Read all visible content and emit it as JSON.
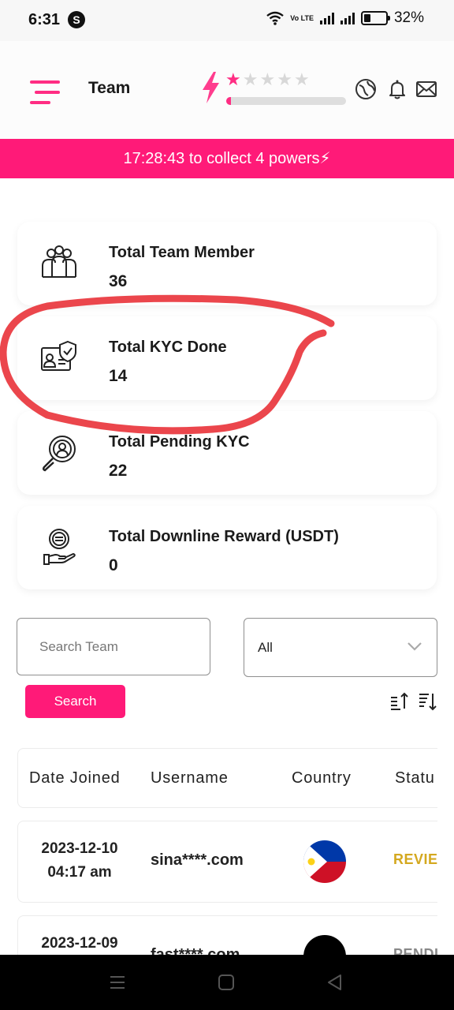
{
  "status_bar": {
    "time": "6:31",
    "app_badge": "S",
    "network": "Vo LTE",
    "battery": "32%"
  },
  "header": {
    "title": "Team",
    "rating_stars": 1,
    "rating_max": 5,
    "power_progress": 0.04,
    "icons": [
      "menu-icon",
      "bolt-icon",
      "star-icon",
      "globe-icon",
      "bell-icon",
      "mail-icon"
    ],
    "accent_color": "#ff1a78"
  },
  "banner": {
    "text": "17:28:43 to collect 4 powers⚡"
  },
  "stats": [
    {
      "label": "Total Team Member",
      "value": "36",
      "icon": "team-icon"
    },
    {
      "label": "Total KYC Done",
      "value": "14",
      "icon": "id-card-shield-icon"
    },
    {
      "label": "Total Pending KYC",
      "value": "22",
      "icon": "search-user-icon"
    },
    {
      "label": "Total Downline Reward (USDT)",
      "value": "0",
      "icon": "coin-hand-icon"
    }
  ],
  "filters": {
    "search_placeholder": "Search Team",
    "select_value": "All",
    "search_button": "Search"
  },
  "table": {
    "headers": [
      "Date Joined",
      "Username",
      "Country",
      "Statu"
    ],
    "rows": [
      {
        "date": "2023-12-10",
        "time": "04:17 am",
        "username": "sina****.com",
        "country_flag": "philippines-flag-icon",
        "status": "REVIEW",
        "status_color": "#d4a81f"
      },
      {
        "date": "2023-12-09",
        "time": "",
        "username": "fast****.com",
        "country_flag": "black-flag-icon",
        "status": "PENDIN",
        "status_color": "#888888"
      }
    ]
  }
}
